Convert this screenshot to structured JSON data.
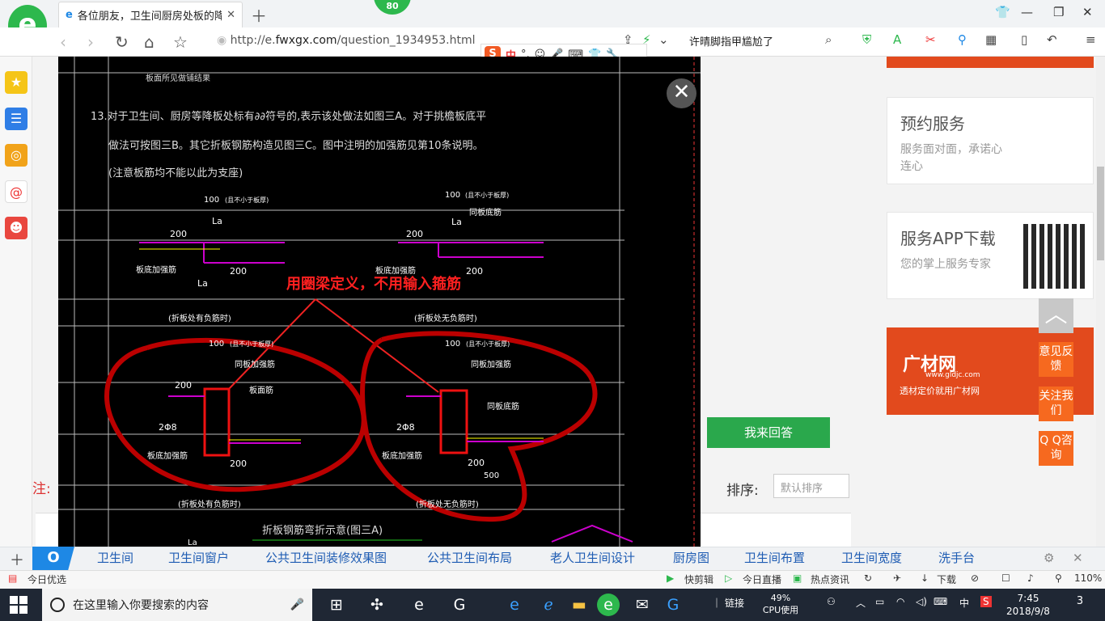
{
  "browser": {
    "tab_title": "各位朋友，卫生间厨房处板的降",
    "tab_icon": "e",
    "badge_count": "80",
    "url_prefix": "http://e.",
    "url_domain": "fwxgx.com",
    "url_path": "/question_1934953.html",
    "search_text": "许晴脚指甲尴尬了",
    "ime": {
      "mode": "中"
    }
  },
  "sidebar": {
    "items": [
      "star-icon",
      "list-icon",
      "weibo-icon",
      "mail-icon",
      "game-icon"
    ]
  },
  "page": {
    "card1": {
      "title": "预约服务",
      "sub": "服务面对面，承诺心连心"
    },
    "card2": {
      "title": "服务APP下载",
      "sub": "您的掌上服务专家"
    },
    "ad": {
      "brand": "广材网",
      "url": "www.gldjc.com",
      "slogan": "透材定价就用广材网"
    },
    "answer_button": "我来回答",
    "sort_label": "排序:",
    "sort_value": "默认排序",
    "note_label": "注:"
  },
  "float_buttons": {
    "feedback": "意见反馈",
    "follow": "关注我们",
    "qq": "Q Q咨询"
  },
  "drawing": {
    "note_line1": "13.对于卫生间、厨房等降板处标有∂∂符号的,表示该处做法如图三A。对于挑檐板底平",
    "note_line2": "做法可按图三B。其它折板钢筋构造见图三C。图中注明的加强筋见第10条说明。",
    "note_line3": "(注意板筋均不能以此为支座)",
    "top_text": "板面所见做铺结果",
    "annotation": "用圈梁定义，不用输入箍筋",
    "dim_100": "100",
    "dim_200": "200",
    "dim_500": "500",
    "dim_la": "La",
    "dim_2phi8": "2Φ8",
    "not_less": "(且不小于板厚)",
    "same_plate": "同板底筋",
    "same_plate2": "同板加强筋",
    "plate_rebar": "板底加强筋",
    "plate_face": "板面筋",
    "case_a": "(折板处有负筋时)",
    "case_b": "(折板处无负筋时)",
    "figure_caption": "折板钢筋弯折示意(图三A)"
  },
  "hot_search": [
    "卫生间",
    "卫生间窗户",
    "公共卫生间装修效果图",
    "公共卫生间布局",
    "老人卫生间设计",
    "厨房图",
    "卫生间布置",
    "卫生间宽度",
    "洗手台"
  ],
  "statusbar": {
    "today": "今日优选",
    "items": [
      "快剪辑",
      "今日直播",
      "热点资讯"
    ],
    "download": "下载",
    "zoom": "110%"
  },
  "taskbar": {
    "search_placeholder": "在这里输入你要搜索的内容",
    "links_label": "链接",
    "cpu_percent": "49%",
    "cpu_label": "CPU使用",
    "ime": "中",
    "time": "7:45",
    "date": "2018/9/8",
    "notifications": "3"
  }
}
